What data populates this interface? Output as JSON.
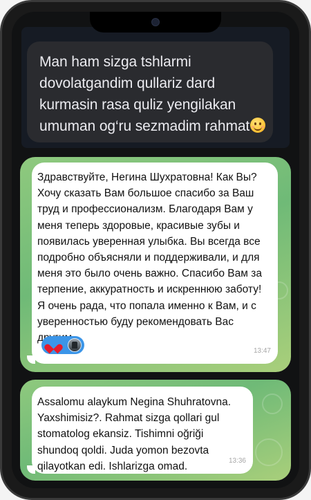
{
  "messages": {
    "incoming_dark": {
      "text": "Man ham sizga tshlarmi dovolatgandim qullariz dard kurmasin rasa quliz yengilakan umuman og‘ru sezmadim rahmat",
      "emoji": "smiling-face-icon"
    },
    "review_ru": {
      "text": "Здравствуйте, Негина Шухратовна! Как Вы? Хочу сказать Вам большое спасибо за Ваш труд и профессионализм. Благодаря Вам у меня теперь здоровые, красивые зубы и появилась уверенная улыбка. Вы всегда все подробно объясняли и поддерживали, и для меня это было очень важно. Спасибо Вам за терпение, аккуратность и искреннюю заботу! Я очень рада, что попала именно к Вам, и с уверенностью буду рекомендовать Вас другим",
      "time": "13:47",
      "reaction": "red-heart-icon"
    },
    "review_uz": {
      "text": "Assalomu alaykum Negina Shuhratovna. Yaxshimisiz?. Rahmat sizga qollari gul stomatolog ekansiz. Tishimni oğriği shundoq qoldi. Juda yomon bezovta qilayotkan edi. Ishlarizga omad.",
      "time": "13:36"
    }
  },
  "colors": {
    "phone_frame": "#1a1a1a",
    "dark_bubble": "#2a2b2f",
    "green_background": "#7bbf79",
    "reaction_pill": "#3b95e8"
  }
}
